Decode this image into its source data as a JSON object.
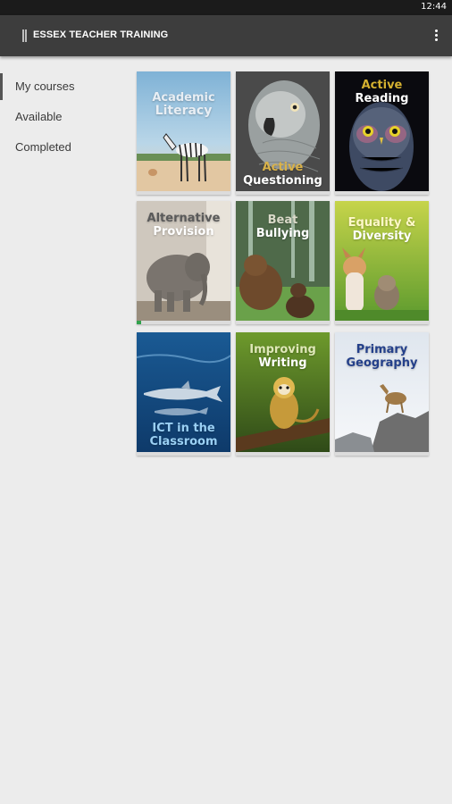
{
  "status_bar": {
    "time": "12:44"
  },
  "app_bar": {
    "title": "ESSEX TEACHER TRAINING",
    "menu_icon": "more-vertical-icon"
  },
  "sidebar": {
    "items": [
      {
        "label": "My courses",
        "active": true
      },
      {
        "label": "Available",
        "active": false
      },
      {
        "label": "Completed",
        "active": false
      }
    ]
  },
  "courses": [
    {
      "line1": "Academic",
      "line2": "Literacy",
      "image": "zebra",
      "progress": 0
    },
    {
      "line1": "Active",
      "line2": "Questioning",
      "image": "grey-parrot",
      "progress": 0
    },
    {
      "line1": "Active",
      "line2": "Reading",
      "image": "great-grey-owl",
      "progress": 0
    },
    {
      "line1": "Alternative",
      "line2": "Provision",
      "image": "elephant",
      "progress": 0.05
    },
    {
      "line1": "Beat",
      "line2": "Bullying",
      "image": "bears",
      "progress": 0
    },
    {
      "line1": "Equality &",
      "line2": "Diversity",
      "image": "dog-and-cat",
      "progress": 0
    },
    {
      "line1": "ICT in the",
      "line2": "Classroom",
      "image": "dolphins",
      "progress": 0
    },
    {
      "line1": "Improving",
      "line2": "Writing",
      "image": "squirrel-monkey",
      "progress": 0
    },
    {
      "line1": "Primary",
      "line2": "Geography",
      "image": "deer-on-rock",
      "progress": 0
    }
  ]
}
